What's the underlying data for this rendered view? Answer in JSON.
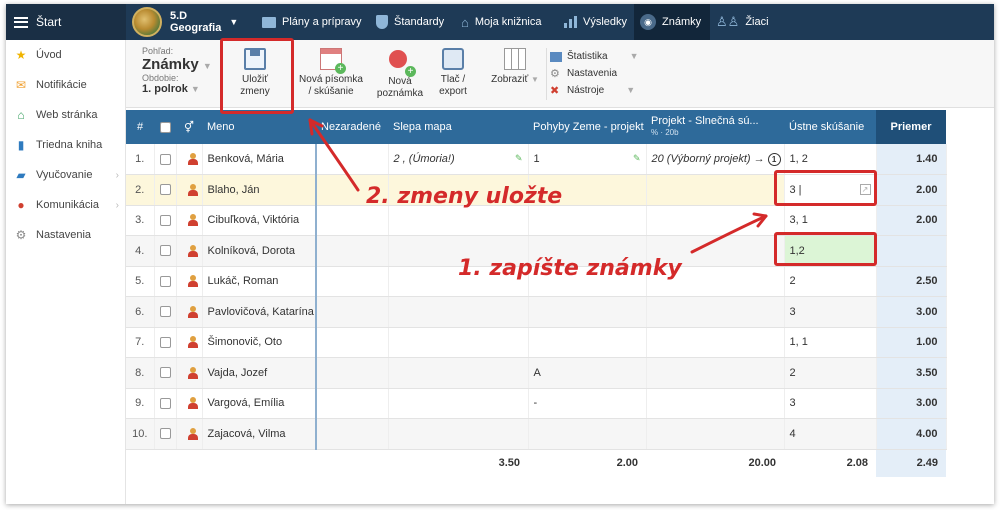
{
  "topbar": {
    "start_label": "Štart",
    "class_name": "5.D",
    "subject": "Geografia",
    "nav": [
      {
        "label": "Plány a prípravy",
        "icon": "folder-icon"
      },
      {
        "label": "Štandardy",
        "icon": "shield-icon"
      },
      {
        "label": "Moja knižnica",
        "icon": "library-icon"
      },
      {
        "label": "Výsledky",
        "icon": "bar-chart-icon"
      },
      {
        "label": "Známky",
        "icon": "grades-icon",
        "active": true
      },
      {
        "label": "Žiaci",
        "icon": "students-icon"
      }
    ]
  },
  "sidebar": {
    "items": [
      {
        "label": "Úvod",
        "icon": "star-icon"
      },
      {
        "label": "Notifikácie",
        "icon": "envelope-icon"
      },
      {
        "label": "Web stránka",
        "icon": "home-icon"
      },
      {
        "label": "Triedna kniha",
        "icon": "book-icon"
      },
      {
        "label": "Vyučovanie",
        "icon": "open-book-icon"
      },
      {
        "label": "Komunikácia",
        "icon": "chat-icon"
      },
      {
        "label": "Nastavenia",
        "icon": "gear-icon"
      }
    ]
  },
  "toolbar": {
    "view_label": "Pohľad:",
    "view_value": "Známky",
    "period_label": "Obdobie:",
    "period_value": "1. polrok",
    "save_line1": "Uložiť",
    "save_line2": "zmeny",
    "newtest_line1": "Nová písomka",
    "newtest_line2": "/ skúšanie",
    "newnote_line1": "Nová",
    "newnote_line2": "poznámka",
    "print_line1": "Tlač /",
    "print_line2": "export",
    "show_label": "Zobraziť",
    "statistics": "Štatistika",
    "settings": "Nastavenia",
    "tools": "Nástroje"
  },
  "table": {
    "headers": {
      "num": "#",
      "name": "Meno",
      "unassigned": "Nezaradené",
      "blind_map": "Slepa mapa",
      "earth_motion": "Pohyby Zeme - projekt",
      "solar_project": "Projekt - Slnečná sú...",
      "solar_sub": "% · 20b",
      "oral": "Ústne skúšanie",
      "average": "Priemer"
    },
    "rows": [
      {
        "num": "1.",
        "name": "Benková, Mária",
        "blind_map": "2 , (Úmoria!)",
        "earth": "1",
        "solar": "20 (Výborný projekt) →",
        "solar_badge": "1",
        "oral": "1, 2",
        "avg": "1.40"
      },
      {
        "num": "2.",
        "name": "Blaho, Ján",
        "blind_map": "",
        "earth": "",
        "solar": "",
        "oral": "3 |",
        "avg": "2.00"
      },
      {
        "num": "3.",
        "name": "Cibuľková, Viktória",
        "blind_map": "",
        "earth": "",
        "solar": "",
        "oral": "3, 1",
        "avg": "2.00"
      },
      {
        "num": "4.",
        "name": "Kolníková, Dorota",
        "blind_map": "",
        "earth": "",
        "solar": "",
        "oral": "1,2",
        "avg": ""
      },
      {
        "num": "5.",
        "name": "Lukáč, Roman",
        "blind_map": "",
        "earth": "",
        "solar": "",
        "oral": "2",
        "avg": "2.50"
      },
      {
        "num": "6.",
        "name": "Pavlovičová, Katarína",
        "blind_map": "",
        "earth": "",
        "solar": "",
        "oral": "3",
        "avg": "3.00"
      },
      {
        "num": "7.",
        "name": "Šimonovič, Oto",
        "blind_map": "",
        "earth": "",
        "solar": "",
        "oral": "1, 1",
        "avg": "1.00"
      },
      {
        "num": "8.",
        "name": "Vajda, Jozef",
        "blind_map": "",
        "earth": "A",
        "solar": "",
        "oral": "2",
        "avg": "3.50"
      },
      {
        "num": "9.",
        "name": "Vargová, Emília",
        "blind_map": "",
        "earth": "-",
        "solar": "",
        "oral": "3",
        "avg": "3.00"
      },
      {
        "num": "10.",
        "name": "Zajacová, Vilma",
        "blind_map": "",
        "earth": "",
        "solar": "",
        "oral": "4",
        "avg": "4.00"
      }
    ],
    "footer": {
      "blind_map": "3.50",
      "earth": "2.00",
      "solar": "20.00",
      "oral": "2.08",
      "avg": "2.49"
    }
  },
  "annotations": {
    "step2": "2. zmeny uložte",
    "step1": "1. zapíšte známky",
    "color": "#d42a2a"
  }
}
